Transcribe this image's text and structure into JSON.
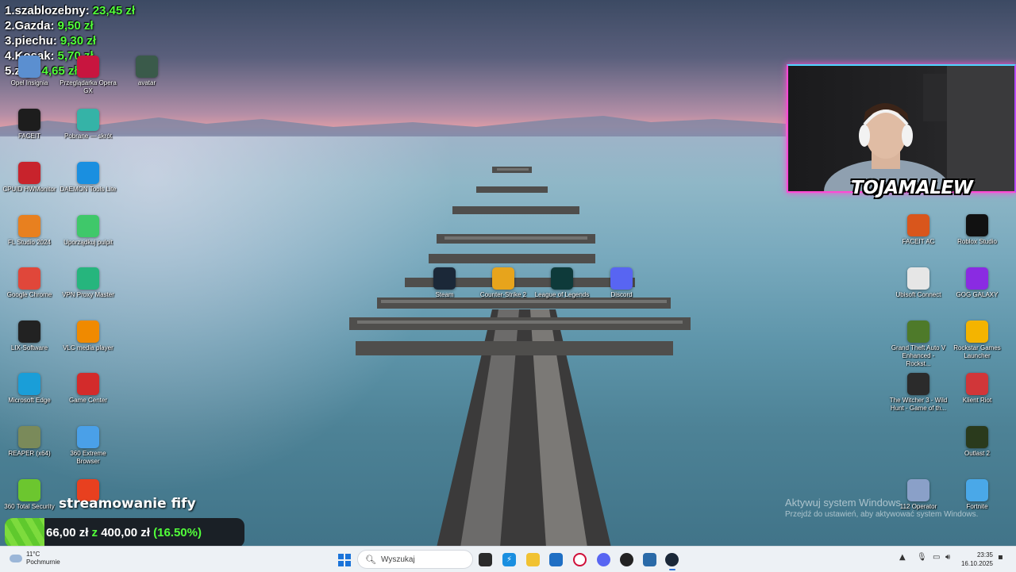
{
  "leaderboard": [
    {
      "name": "1.szablozebny:",
      "amount": "23,45 zł"
    },
    {
      "name": "2.Gazda:",
      "amount": "9,50 zł"
    },
    {
      "name": "3.piechu:",
      "amount": "9,30 zł"
    },
    {
      "name": "4.Kosak:",
      "amount": "5,70 zł"
    },
    {
      "name": "5.zigi:",
      "amount": "4,65 zł"
    }
  ],
  "desktop_left": [
    {
      "label": "Opel Insignia",
      "icon": "car-icon",
      "color": "#5b8fd0"
    },
    {
      "label": "Przeglądarka Opera GX",
      "icon": "opera-gx-icon",
      "color": "#c8153f"
    },
    {
      "label": "avatar",
      "icon": "avatar-image-icon",
      "color": "#3a5a4a"
    },
    {
      "label": "FACEIT",
      "icon": "faceit-icon",
      "color": "#1d1d1d"
    },
    {
      "label": "Pobrane — skrót",
      "icon": "downloads-folder-icon",
      "color": "#35b3a7"
    },
    {
      "label": "CPUID HWMonitor",
      "icon": "hwmonitor-icon",
      "color": "#c8232c"
    },
    {
      "label": "DAEMON Tools Lite",
      "icon": "daemon-tools-icon",
      "color": "#1a8fe0"
    },
    {
      "label": "FL Studio 2024",
      "icon": "fl-studio-icon",
      "color": "#e8801f"
    },
    {
      "label": "Uporządkuj pulpit",
      "icon": "organize-desktop-icon",
      "color": "#3fc86a"
    },
    {
      "label": "Google Chrome",
      "icon": "chrome-icon",
      "color": "#e0473a"
    },
    {
      "label": "VPN Proxy Master",
      "icon": "vpn-icon",
      "color": "#26b57d"
    },
    {
      "label": "LIX-Software",
      "icon": "lix-software-icon",
      "color": "#222222"
    },
    {
      "label": "VLC media player",
      "icon": "vlc-icon",
      "color": "#f08a00"
    },
    {
      "label": "Microsoft Edge",
      "icon": "edge-icon",
      "color": "#1a9ed8"
    },
    {
      "label": "Game Center",
      "icon": "game-center-icon",
      "color": "#d32b2b"
    },
    {
      "label": "REAPER (x64)",
      "icon": "reaper-icon",
      "color": "#7a8a5a"
    },
    {
      "label": "360 Extreme Browser",
      "icon": "360-browser-icon",
      "color": "#4aa0e8"
    },
    {
      "label": "360 Total Security",
      "icon": "360-security-icon",
      "color": "#6cc62f"
    },
    {
      "label": "",
      "icon": "ea-app-icon",
      "color": "#e8401f"
    }
  ],
  "desktop_center": [
    {
      "label": "Steam",
      "icon": "steam-icon",
      "color": "#1b2838"
    },
    {
      "label": "Counter-Strike 2",
      "icon": "counter-strike-icon",
      "color": "#e7a41c"
    },
    {
      "label": "League of Legends",
      "icon": "league-of-legends-icon",
      "color": "#0e3a3a"
    },
    {
      "label": "Discord",
      "icon": "discord-icon",
      "color": "#5865f2"
    }
  ],
  "desktop_right": [
    {
      "label": "FACEIT AC",
      "icon": "faceit-ac-icon",
      "color": "#d9561c"
    },
    {
      "label": "Roblox Studio",
      "icon": "roblox-studio-icon",
      "color": "#111111"
    },
    {
      "label": "Ubisoft Connect",
      "icon": "ubisoft-icon",
      "color": "#e6e6e6"
    },
    {
      "label": "GOG GALAXY",
      "icon": "gog-galaxy-icon",
      "color": "#8a2be2"
    },
    {
      "label": "Grand Theft Auto V Enhanced - Rockst...",
      "icon": "gta-v-icon",
      "color": "#4e7a2a"
    },
    {
      "label": "Rockstar Games Launcher",
      "icon": "rockstar-icon",
      "color": "#f4b400"
    },
    {
      "label": "The Witcher 3 - Wild Hunt - Game of th...",
      "icon": "witcher-icon",
      "color": "#2b2b2b"
    },
    {
      "label": "Klient Riot",
      "icon": "riot-client-icon",
      "color": "#d13639"
    },
    {
      "label": "Outlast 2",
      "icon": "outlast-icon",
      "color": "#2a3a1c"
    },
    {
      "label": "112 Operator",
      "icon": "112-operator-icon",
      "color": "#8aa0c8"
    },
    {
      "label": "Fortnite",
      "icon": "fortnite-icon",
      "color": "#4aa8e8"
    }
  ],
  "webcam": {
    "streamer_name": "TOJAMALEW"
  },
  "donation_goal": {
    "title": "streamowanie fify",
    "current": "66,00 zł",
    "connector": "z",
    "target": "400,00 zł",
    "percent_text": "(16.50%)",
    "fraction": 0.165
  },
  "activation": {
    "line1": "Aktywuj system Windows",
    "line2": "Przejdź do ustawień, aby aktywować system Windows."
  },
  "taskbar": {
    "weather_temp": "11°C",
    "weather_desc": "Pochmurnie",
    "search_placeholder": "Wyszukaj",
    "time": "23:35",
    "date": "16.10.2025",
    "apps": [
      "start-icon",
      "task-view-icon",
      "daemon-tools-icon",
      "file-explorer-icon",
      "store-icon",
      "opera-gx-icon",
      "discord-icon",
      "riot-client-icon",
      "app-icon",
      "steam-icon"
    ]
  }
}
